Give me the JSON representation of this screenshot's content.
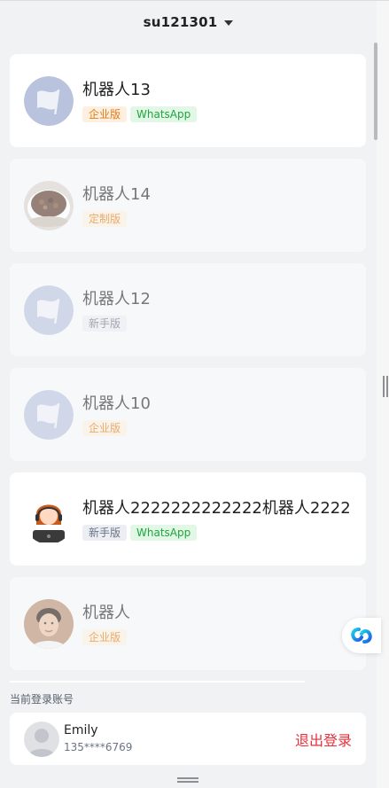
{
  "header": {
    "account": "su121301"
  },
  "bots": [
    {
      "name": "机器人13",
      "avatar": "flag-avatar",
      "dim": false,
      "badges": [
        {
          "label": "企业版",
          "kind": "enterprise"
        },
        {
          "label": "WhatsApp",
          "kind": "whatsapp"
        }
      ]
    },
    {
      "name": "机器人14",
      "avatar": "food-photo-avatar",
      "dim": true,
      "badges": [
        {
          "label": "定制版",
          "kind": "custom"
        }
      ]
    },
    {
      "name": "机器人12",
      "avatar": "flag-avatar",
      "dim": true,
      "badges": [
        {
          "label": "新手版",
          "kind": "novice"
        }
      ]
    },
    {
      "name": "机器人10",
      "avatar": "flag-avatar",
      "dim": true,
      "badges": [
        {
          "label": "企业版",
          "kind": "enterprise"
        }
      ]
    },
    {
      "name": "机器人2222222222222机器人2222",
      "avatar": "support-agent-avatar",
      "dim": false,
      "badges": [
        {
          "label": "新手版",
          "kind": "novice"
        },
        {
          "label": "WhatsApp",
          "kind": "whatsapp"
        }
      ]
    },
    {
      "name": "机器人",
      "avatar": "person-photo-avatar",
      "dim": true,
      "badges": [
        {
          "label": "企业版",
          "kind": "enterprise"
        }
      ]
    }
  ],
  "current": {
    "label": "当前登录账号",
    "name": "Emily",
    "phone": "135****6769",
    "logout": "退出登录"
  },
  "colors": {
    "accent_red": "#e8303a",
    "enterprise_orange": "#e07b14",
    "whatsapp_green": "#1ea53d"
  }
}
